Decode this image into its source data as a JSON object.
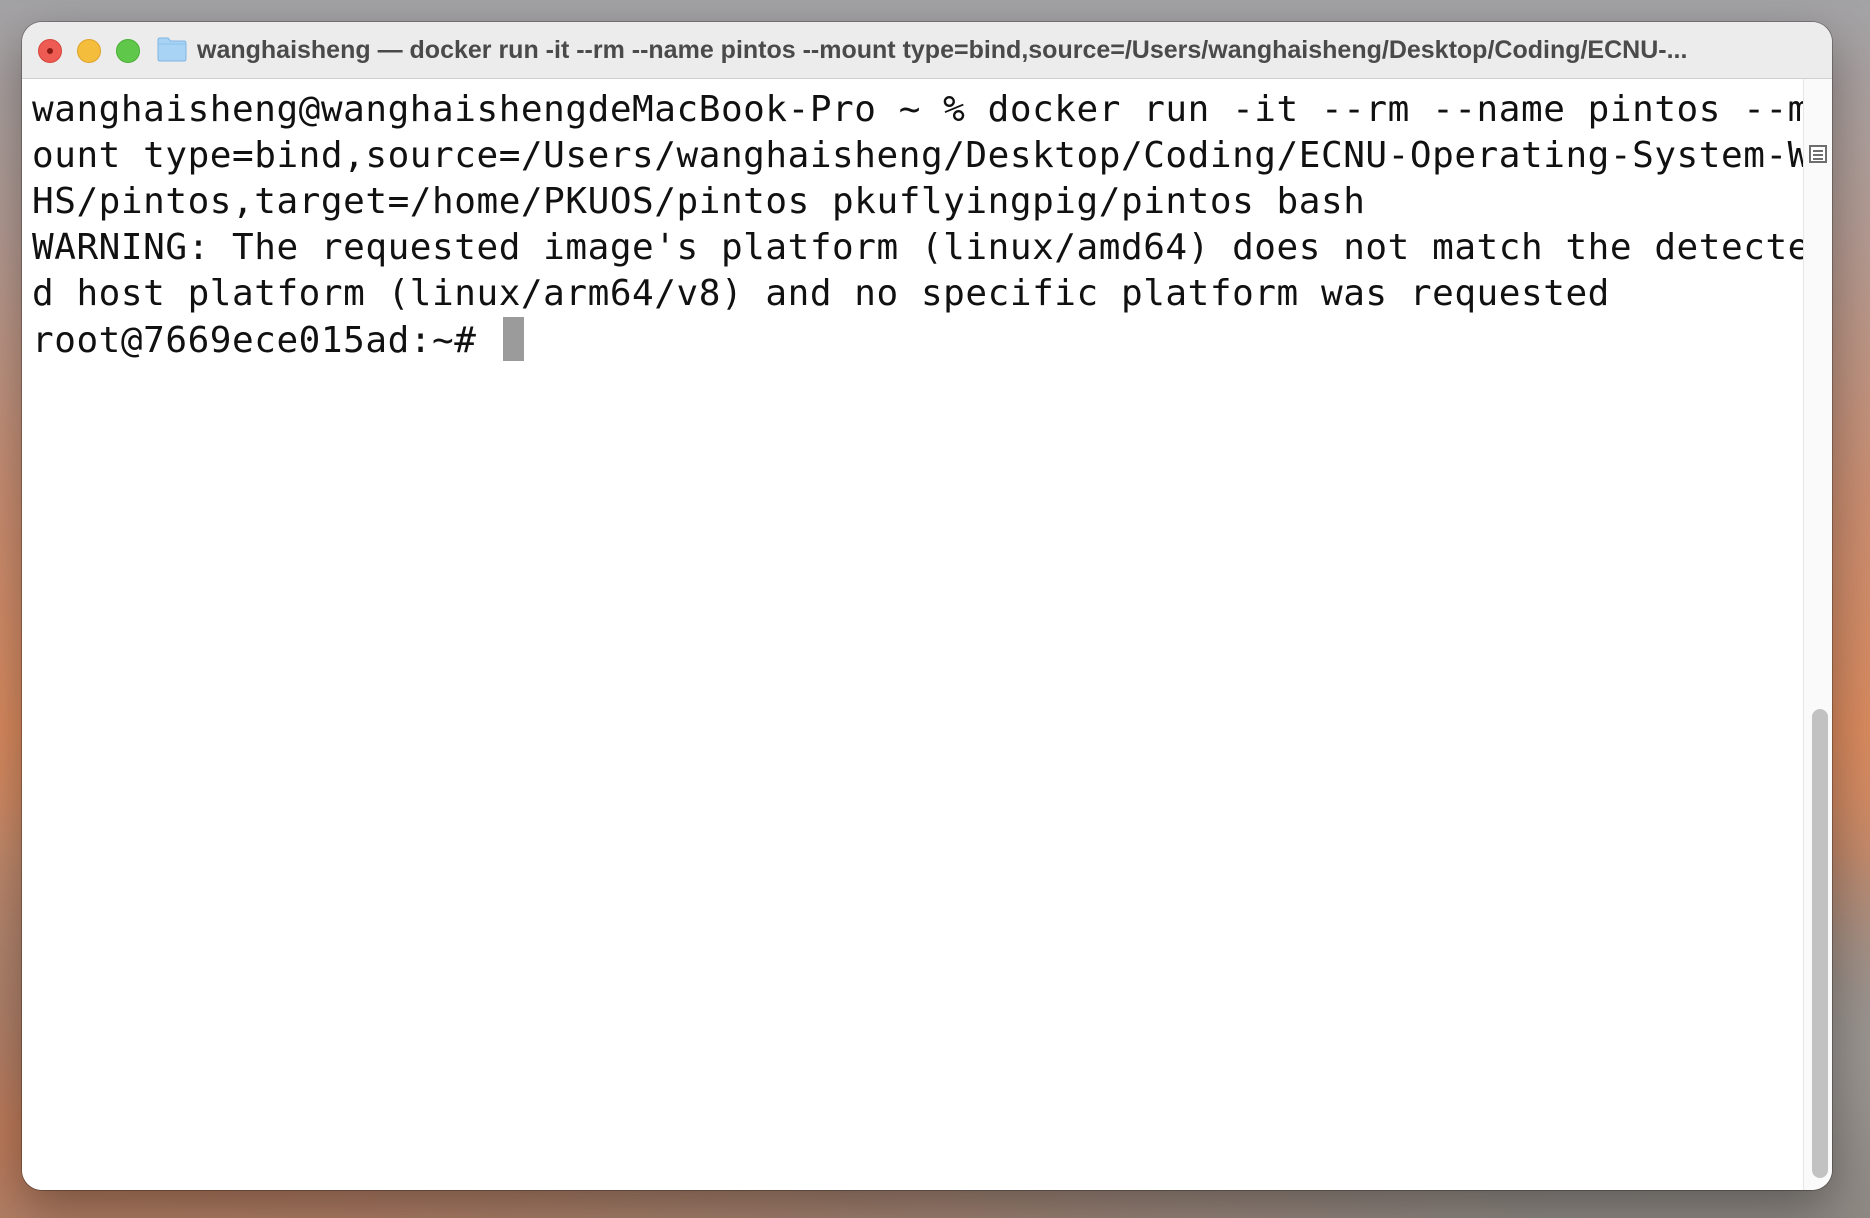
{
  "window": {
    "title": "wanghaisheng — docker run -it --rm --name pintos --mount type=bind,source=/Users/wanghaisheng/Desktop/Coding/ECNU-..."
  },
  "icons": {
    "title_icon": "folder-icon",
    "split_pane": "split-pane-icon"
  },
  "colors": {
    "close": "#ee5b52",
    "minimize": "#f5bd3c",
    "zoom": "#5fc84a",
    "cursor": "#9b9b9b"
  },
  "terminal": {
    "lines": [
      "wanghaisheng@wanghaishengdeMacBook-Pro ~ % docker run -it --rm --name pintos --m",
      "ount type=bind,source=/Users/wanghaisheng/Desktop/Coding/ECNU-Operating-System-W",
      "HS/pintos,target=/home/PKUOS/pintos pkuflyingpig/pintos bash",
      "WARNING: The requested image's platform (linux/amd64) does not match the detecte",
      "d host platform (linux/arm64/v8) and no specific platform was requested"
    ],
    "prompt": "root@7669ece015ad:~# "
  }
}
